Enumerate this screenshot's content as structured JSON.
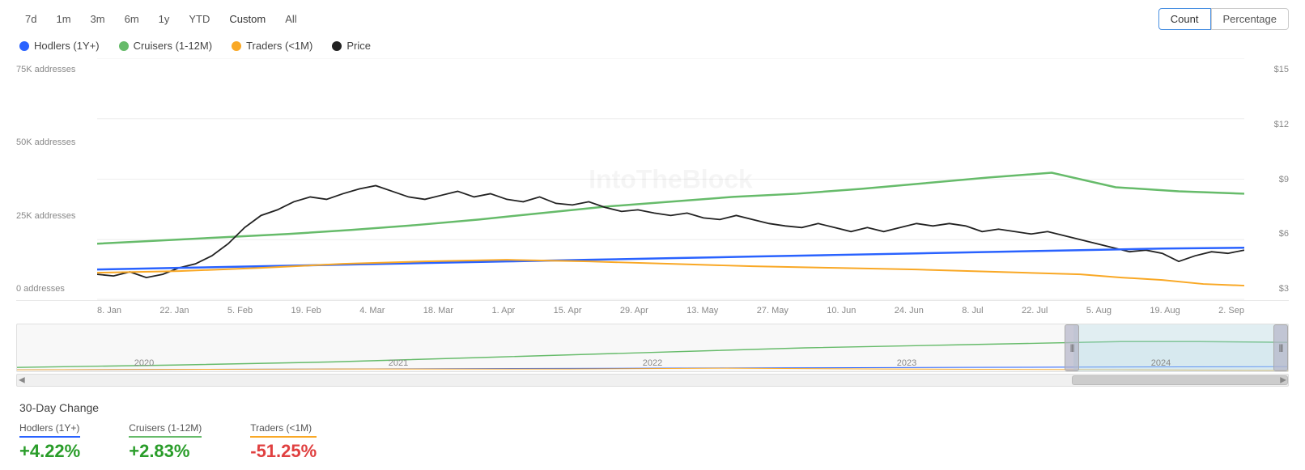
{
  "toolbar": {
    "time_buttons": [
      "7d",
      "1m",
      "3m",
      "6m",
      "1y",
      "YTD",
      "Custom",
      "All"
    ],
    "active_time": "Custom",
    "view_buttons": [
      "Count",
      "Percentage"
    ],
    "active_view": "Count"
  },
  "legend": [
    {
      "label": "Hodlers (1Y+)",
      "color": "#2962ff",
      "id": "hodlers"
    },
    {
      "label": "Cruisers (1-12M)",
      "color": "#66bb6a",
      "id": "cruisers"
    },
    {
      "label": "Traders (<1M)",
      "color": "#f9a825",
      "id": "traders"
    },
    {
      "label": "Price",
      "color": "#222222",
      "id": "price"
    }
  ],
  "chart": {
    "watermark": "IntoTheBlock",
    "y_axis_left": [
      "75K addresses",
      "50K addresses",
      "25K addresses",
      "0 addresses"
    ],
    "y_axis_right": [
      "$15",
      "$12",
      "$9",
      "$6",
      "$3"
    ],
    "x_axis": [
      "8. Jan",
      "22. Jan",
      "5. Feb",
      "19. Feb",
      "4. Mar",
      "18. Mar",
      "1. Apr",
      "15. Apr",
      "29. Apr",
      "13. May",
      "27. May",
      "10. Jun",
      "24. Jun",
      "8. Jul",
      "22. Jul",
      "5. Aug",
      "19. Aug",
      "2. Sep"
    ]
  },
  "navigator": {
    "labels": [
      "2020",
      "2021",
      "2022",
      "2023",
      "2024"
    ]
  },
  "change_section": {
    "title": "30-Day Change",
    "items": [
      {
        "category": "Hodlers (1Y+)",
        "value": "+4.22%",
        "type": "positive",
        "border_color": "#2962ff"
      },
      {
        "category": "Cruisers (1-12M)",
        "value": "+2.83%",
        "type": "positive",
        "border_color": "#66bb6a"
      },
      {
        "category": "Traders (<1M)",
        "value": "-51.25%",
        "type": "negative",
        "border_color": "#f9a825"
      }
    ]
  }
}
